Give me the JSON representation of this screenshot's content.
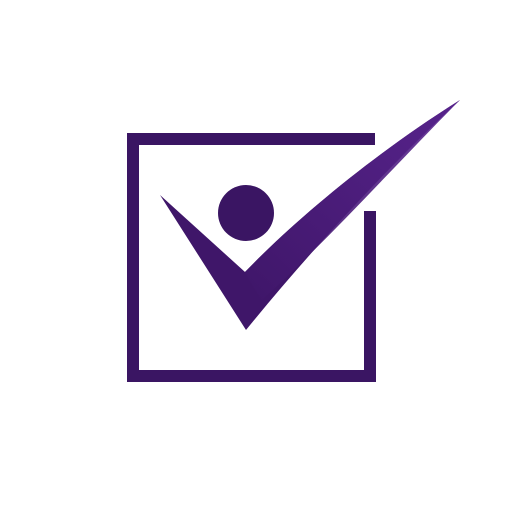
{
  "logo": {
    "icon": "checkbox-person-check-icon",
    "colors": {
      "frame": "#3a1563",
      "check_dark": "#3f1669",
      "check_light": "#5a2590",
      "head": "#3a1563",
      "background": "#ffffff"
    }
  }
}
